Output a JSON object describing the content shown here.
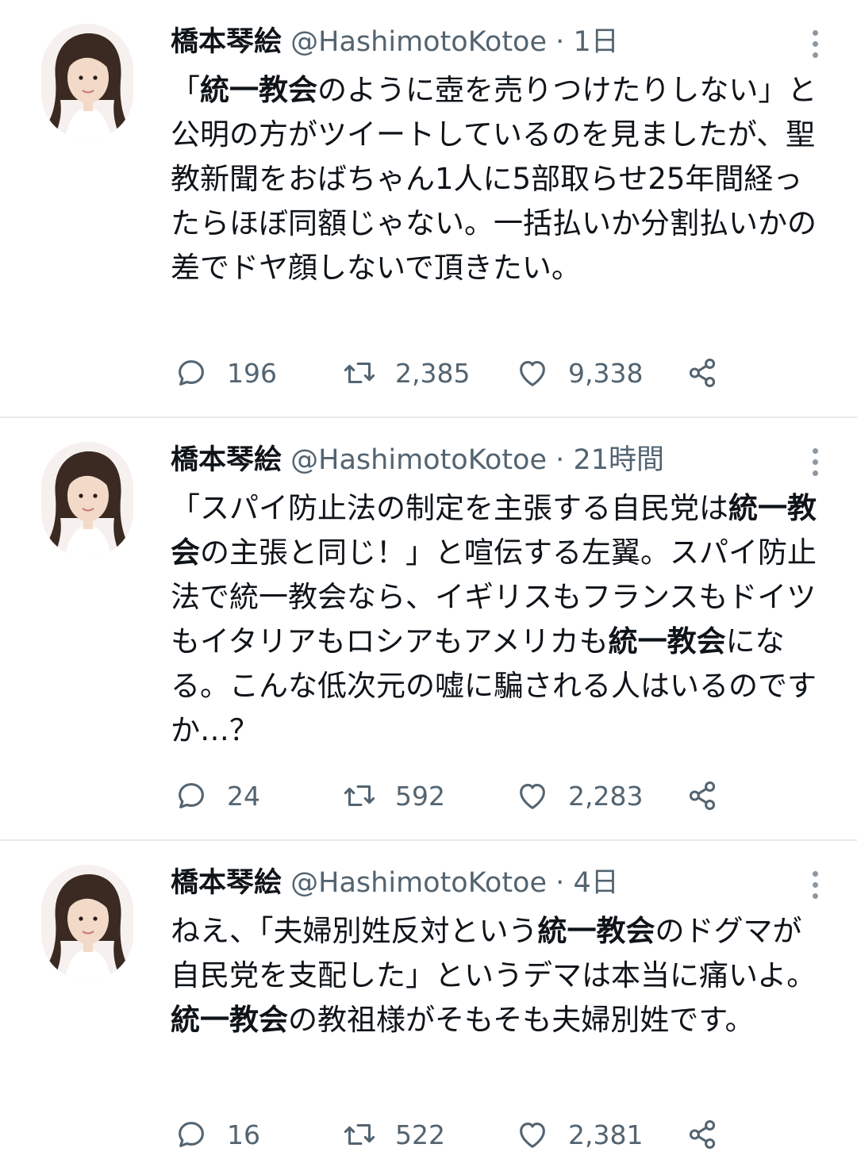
{
  "tweets": [
    {
      "name": "橋本琴絵",
      "handle": "@HashimotoKotoe",
      "separator": "·",
      "time": "1日",
      "body": [
        {
          "t": "「"
        },
        {
          "t": "統一教会",
          "b": true
        },
        {
          "t": "のように壺を売りつけたりしない」と公明の方がツイートしているのを見ましたが、聖教新聞をおばちゃん1人に5部取らせ25年間経ったらほぼ同額じゃない。一括払いか分割払いかの差でドヤ顔しないで頂きたい。"
        }
      ],
      "replies": "196",
      "retweets": "2,385",
      "likes": "9,338"
    },
    {
      "name": "橋本琴絵",
      "handle": "@HashimotoKotoe",
      "separator": "·",
      "time": "21時間",
      "body": [
        {
          "t": "「スパイ防止法の制定を主張する自民党は"
        },
        {
          "t": "統一教会",
          "b": true
        },
        {
          "t": "の主張と同じ！」と喧伝する左翼。スパイ防止法で統一教会なら、イギリスもフランスもドイツもイタリアもロシアもアメリカも"
        },
        {
          "t": "統一教会",
          "b": true
        },
        {
          "t": "になる。こんな低次元の嘘に騙される人はいるのですか…？"
        }
      ],
      "replies": "24",
      "retweets": "592",
      "likes": "2,283"
    },
    {
      "name": "橋本琴絵",
      "handle": "@HashimotoKotoe",
      "separator": "·",
      "time": "4日",
      "body": [
        {
          "t": "ねえ、「夫婦別姓反対という"
        },
        {
          "t": "統一教会",
          "b": true
        },
        {
          "t": "のドグマが自民党を支配した」というデマは本当に痛いよ。"
        },
        {
          "t": "統一教会",
          "b": true
        },
        {
          "t": "の教祖様がそもそも夫婦別姓です。"
        }
      ],
      "replies": "16",
      "retweets": "522",
      "likes": "2,381"
    }
  ],
  "icons": {
    "reply": "reply-icon",
    "retweet": "retweet-icon",
    "like": "heart-icon",
    "share": "share-icon",
    "more": "more-vertical-icon"
  },
  "colors": {
    "text": "#0f1419",
    "secondary": "#536471",
    "divider": "#e6e9eb"
  }
}
